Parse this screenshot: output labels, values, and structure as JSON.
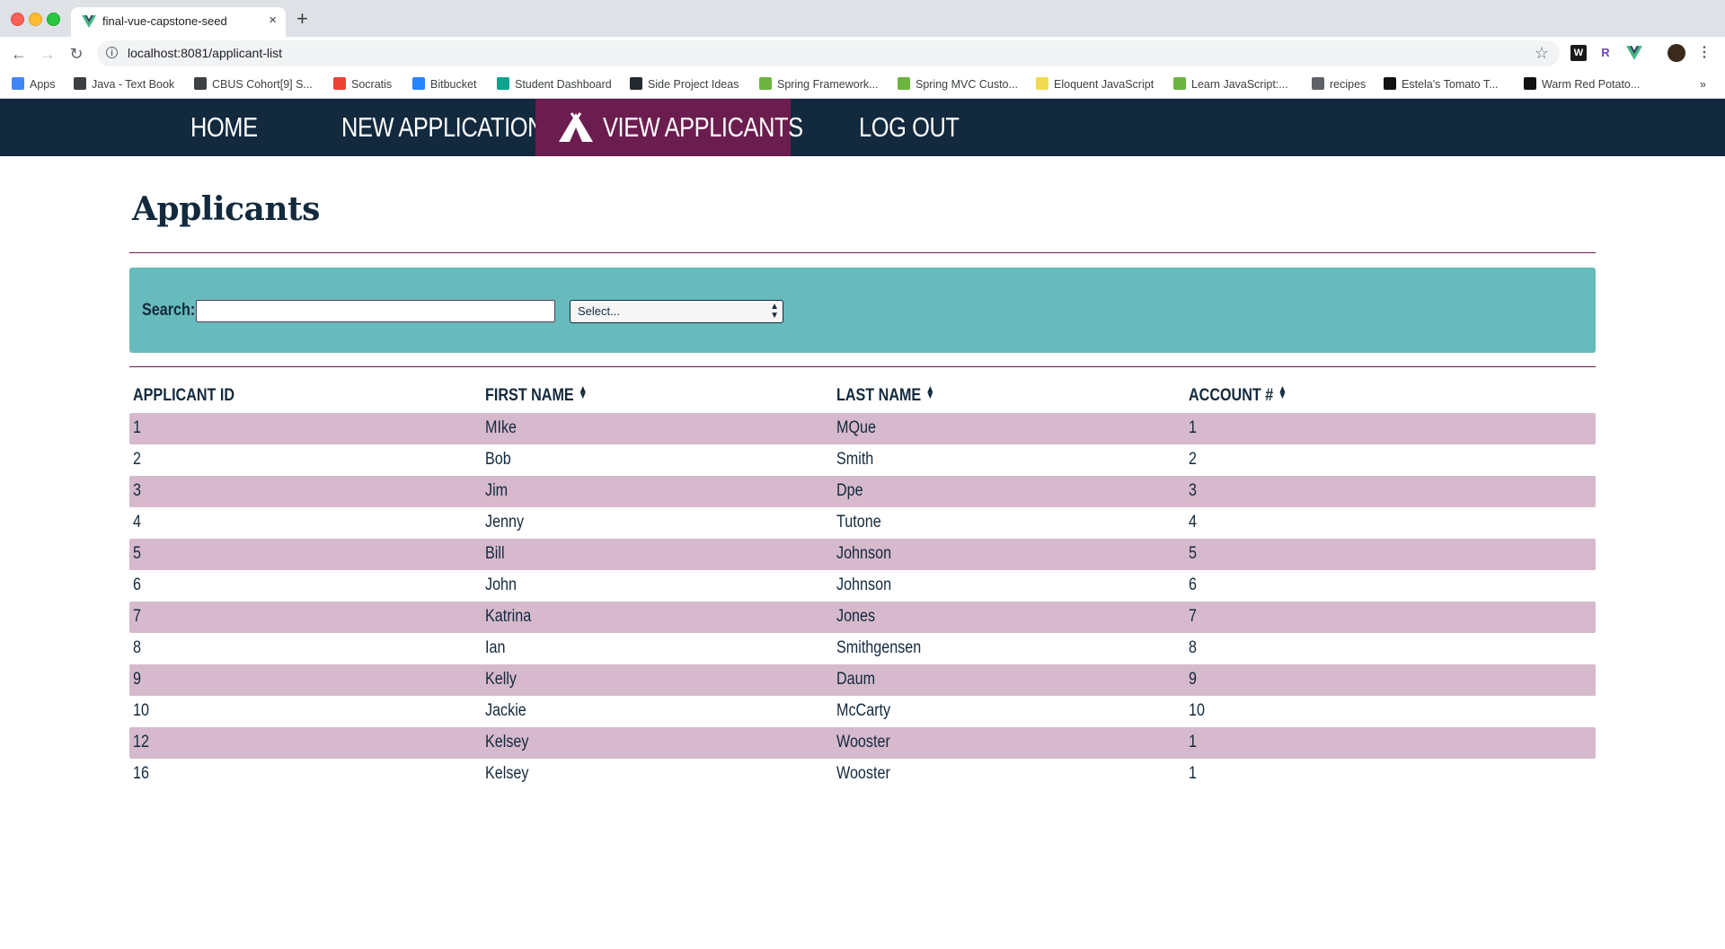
{
  "browser": {
    "tab_title": "final-vue-capstone-seed",
    "close": "×",
    "new_tab": "+",
    "url": "localhost:8081/applicant-list",
    "bookmarks": [
      {
        "label": "Apps",
        "icon": "apps-grid-icon",
        "color": "#4285f4"
      },
      {
        "label": "Java - Text Book",
        "icon": "book-icon",
        "color": "#3c4043"
      },
      {
        "label": "CBUS Cohort[9] S...",
        "icon": "board-icon",
        "color": "#3c4043"
      },
      {
        "label": "Socratis",
        "icon": "socratis-icon",
        "color": "#ea4335"
      },
      {
        "label": "Bitbucket",
        "icon": "bitbucket-icon",
        "color": "#2684ff"
      },
      {
        "label": "Student Dashboard",
        "icon": "dashboard-icon",
        "color": "#0aa58c"
      },
      {
        "label": "Side Project Ideas",
        "icon": "github-icon",
        "color": "#24292e"
      },
      {
        "label": "Spring Framework...",
        "icon": "spring-icon",
        "color": "#6db33f"
      },
      {
        "label": "Spring MVC Custo...",
        "icon": "leaf-icon",
        "color": "#6db33f"
      },
      {
        "label": "Eloquent JavaScript",
        "icon": "ejs-icon",
        "color": "#f0db4f"
      },
      {
        "label": "Learn JavaScript:...",
        "icon": "learn-js-icon",
        "color": "#6db33f"
      },
      {
        "label": "recipes",
        "icon": "folder-icon",
        "color": "#5f6368"
      },
      {
        "label": "Estela's Tomato T...",
        "icon": "s-icon",
        "color": "#111111"
      },
      {
        "label": "Warm Red Potato...",
        "icon": "s-icon",
        "color": "#111111"
      }
    ],
    "overflow": "»"
  },
  "nav": {
    "home": "HOME",
    "new_application": "NEW APPLICATION",
    "view_applicants": "VIEW APPLICANTS",
    "log_out": "LOG OUT",
    "active_color": "#6c1d4f",
    "bar_color": "#13293d"
  },
  "page": {
    "title": "Applicants"
  },
  "search": {
    "label": "Search:",
    "value": "",
    "select_value": "Select...",
    "panel_color": "#67bbbc"
  },
  "table": {
    "headers": [
      "APPLICANT ID",
      "FIRST NAME",
      "LAST NAME",
      "ACCOUNT #"
    ],
    "sortable": [
      false,
      true,
      true,
      true
    ],
    "rows": [
      [
        "1",
        "MIke",
        "MQue",
        "1"
      ],
      [
        "2",
        "Bob",
        "Smith",
        "2"
      ],
      [
        "3",
        "Jim",
        "Dpe",
        "3"
      ],
      [
        "4",
        "Jenny",
        "Tutone",
        "4"
      ],
      [
        "5",
        "Bill",
        "Johnson",
        "5"
      ],
      [
        "6",
        "John",
        "Johnson",
        "6"
      ],
      [
        "7",
        "Katrina",
        "Jones",
        "7"
      ],
      [
        "8",
        "Ian",
        "Smithgensen",
        "8"
      ],
      [
        "9",
        "Kelly",
        "Daum",
        "9"
      ],
      [
        "10",
        "Jackie",
        "McCarty",
        "10"
      ],
      [
        "12",
        "Kelsey",
        "Wooster",
        "1"
      ],
      [
        "16",
        "Kelsey",
        "Wooster",
        "1"
      ]
    ],
    "stripe_color": "#d6b9cc"
  }
}
